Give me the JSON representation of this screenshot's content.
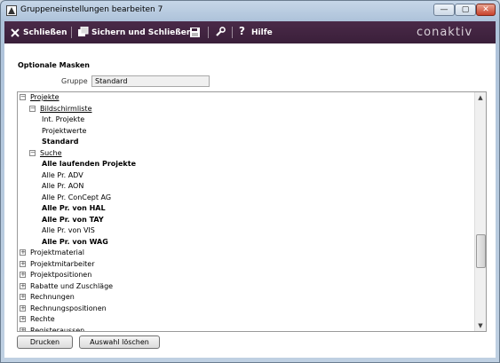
{
  "window": {
    "title": "Gruppeneinstellungen bearbeiten 7",
    "min_glyph": "—",
    "max_glyph": "▢",
    "close_glyph": "✕"
  },
  "toolbar": {
    "close_label": "Schließen",
    "save_close_label": "Sichern und Schließen",
    "help_label": "Hilfe",
    "brand": "conaktiv",
    "bg_color": "#3e233d"
  },
  "content": {
    "section_title": "Optionale Masken",
    "gruppe_label": "Gruppe",
    "gruppe_value": "Standard"
  },
  "tree": {
    "rows": [
      {
        "label": "Projekte",
        "expander": "−",
        "style": "link"
      },
      {
        "label": "Bildschirmliste",
        "expander": "−",
        "style": "link"
      },
      {
        "label": "Int. Projekte",
        "style": "normal"
      },
      {
        "label": "Projektwerte",
        "style": "normal"
      },
      {
        "label": "Standard",
        "style": "bold"
      },
      {
        "label": "Suche",
        "expander": "−",
        "style": "link"
      },
      {
        "label": "Alle laufenden Projekte",
        "style": "bold"
      },
      {
        "label": "Alle Pr. ADV",
        "style": "normal"
      },
      {
        "label": "Alle Pr. AON",
        "style": "normal"
      },
      {
        "label": "Alle Pr. ConCept AG",
        "style": "normal"
      },
      {
        "label": "Alle Pr. von HAL",
        "style": "bold"
      },
      {
        "label": "Alle Pr. von TAY",
        "style": "bold"
      },
      {
        "label": "Alle Pr. von VIS",
        "style": "normal"
      },
      {
        "label": "Alle Pr. von WAG",
        "style": "bold"
      },
      {
        "label": "Projektmaterial",
        "expander": "+",
        "style": "normal"
      },
      {
        "label": "Projektmitarbeiter",
        "expander": "+",
        "style": "normal"
      },
      {
        "label": "Projektpositionen",
        "expander": "+",
        "style": "normal"
      },
      {
        "label": "Rabatte und Zuschläge",
        "expander": "+",
        "style": "normal"
      },
      {
        "label": "Rechnungen",
        "expander": "+",
        "style": "normal"
      },
      {
        "label": "Rechnungspositionen",
        "expander": "+",
        "style": "normal"
      },
      {
        "label": "Rechte",
        "expander": "+",
        "style": "normal"
      },
      {
        "label": "Registeraussen",
        "expander": "+",
        "style": "normal"
      }
    ],
    "scroll_up": "▲",
    "scroll_down": "▼"
  },
  "buttons": {
    "print_label": "Drucken",
    "clear_label": "Auswahl löschen"
  }
}
